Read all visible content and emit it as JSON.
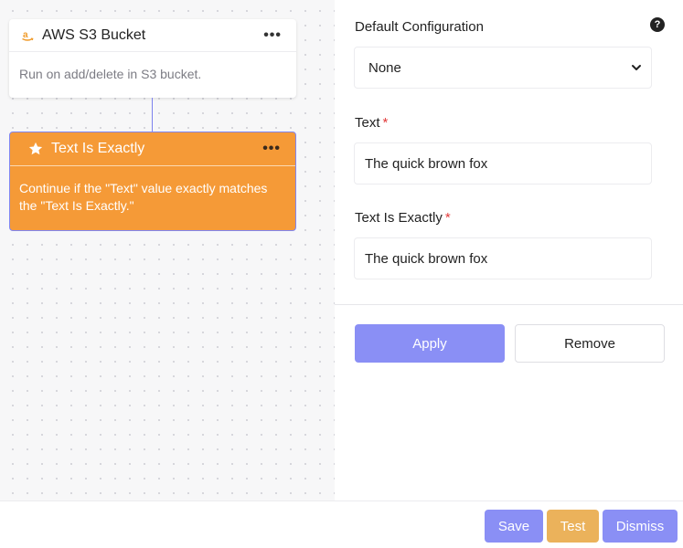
{
  "canvas": {
    "trigger_node": {
      "title": "AWS S3 Bucket",
      "icon": "amazon-icon",
      "menu": "•••",
      "description": "Run on add/delete in S3 bucket."
    },
    "filter_node": {
      "title": "Text Is Exactly",
      "icon": "star-icon",
      "menu": "•••",
      "description": "Continue if the \"Text\" value exactly matches the \"Text Is Exactly.\""
    }
  },
  "panel": {
    "default_config": {
      "label": "Default Configuration",
      "selected": "None",
      "help": "?"
    },
    "text_field": {
      "label": "Text",
      "required_mark": "*",
      "value": "The quick brown fox"
    },
    "text_is_exactly_field": {
      "label": "Text Is Exactly",
      "required_mark": "*",
      "value": "The quick brown fox"
    },
    "apply_label": "Apply",
    "remove_label": "Remove"
  },
  "footer": {
    "save_label": "Save",
    "test_label": "Test",
    "dismiss_label": "Dismiss"
  },
  "colors": {
    "accent": "#8a8ff5",
    "node_orange": "#f59a37",
    "test_button": "#ebb25b",
    "required": "#e23b3b"
  }
}
